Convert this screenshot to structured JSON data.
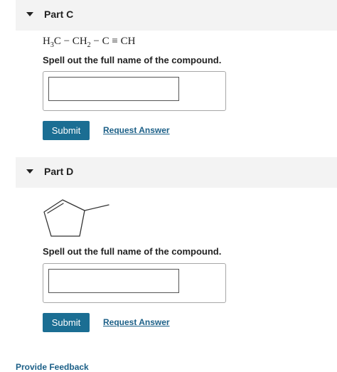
{
  "part_c": {
    "title": "Part C",
    "formula": {
      "h": "H",
      "sub3": "3",
      "c1": "C − CH",
      "sub2": "2",
      "rest": " − C ≡ CH"
    },
    "prompt": "Spell out the full name of the compound.",
    "answer_value": "",
    "submit_label": "Submit",
    "request_label": "Request Answer"
  },
  "part_d": {
    "title": "Part D",
    "structure_icon": "methylcyclopentene-structure",
    "prompt": "Spell out the full name of the compound.",
    "answer_value": "",
    "submit_label": "Submit",
    "request_label": "Request Answer"
  },
  "footer": {
    "link_label": "Provide Feedback"
  }
}
